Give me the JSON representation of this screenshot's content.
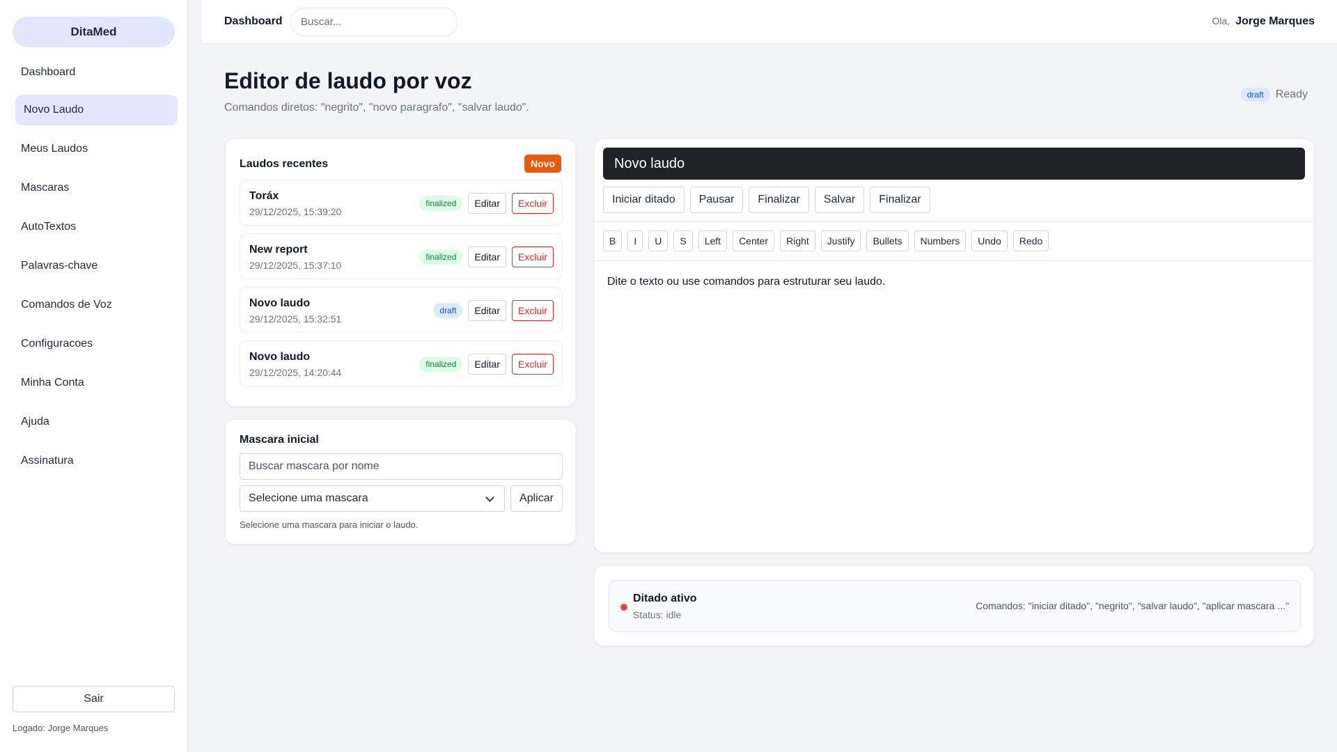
{
  "sidebar": {
    "brand": "DitaMed",
    "items": [
      {
        "label": "Dashboard"
      },
      {
        "label": "Novo Laudo"
      },
      {
        "label": "Meus Laudos"
      },
      {
        "label": "Mascaras"
      },
      {
        "label": "AutoTextos"
      },
      {
        "label": "Palavras-chave"
      },
      {
        "label": "Comandos de Voz"
      },
      {
        "label": "Configuracoes"
      },
      {
        "label": "Minha Conta"
      },
      {
        "label": "Ajuda"
      },
      {
        "label": "Assinatura"
      }
    ],
    "active_item": "Novo Laudo",
    "logout_label": "Sair",
    "logged_in_text": "Logado: Jorge Marques"
  },
  "topbar": {
    "title": "Dashboard",
    "search_placeholder": "Buscar...",
    "greeting": "Ola,",
    "user_name": "Jorge Marques"
  },
  "header": {
    "title": "Editor de laudo por voz",
    "subtitle": "Comandos diretos: \"negrito\", \"novo paragrafo\", \"salvar laudo\".",
    "status_badge": "draft",
    "status_text": "Ready"
  },
  "recent": {
    "title": "Laudos recentes",
    "new_label": "Novo",
    "edit_label": "Editar",
    "delete_label": "Excluir",
    "reports": [
      {
        "name": "Toráx",
        "date": "29/12/2025, 15:39:20",
        "status": "finalized"
      },
      {
        "name": "New report",
        "date": "29/12/2025, 15:37:10",
        "status": "finalized"
      },
      {
        "name": "Novo laudo",
        "date": "29/12/2025, 15:32:51",
        "status": "draft"
      },
      {
        "name": "Novo laudo",
        "date": "29/12/2025, 14:20:44",
        "status": "finalized"
      }
    ]
  },
  "mask": {
    "title": "Mascara inicial",
    "search_placeholder": "Buscar mascara por nome",
    "select_value": "Selecione uma mascara",
    "apply_label": "Aplicar",
    "hint": "Selecione uma mascara para iniciar o laudo."
  },
  "editor": {
    "title_value": "Novo laudo",
    "actions": [
      "Iniciar ditado",
      "Pausar",
      "Finalizar",
      "Salvar",
      "Finalizar"
    ],
    "format_buttons": [
      "B",
      "I",
      "U",
      "S",
      "Left",
      "Center",
      "Right",
      "Justify",
      "Bullets",
      "Numbers",
      "Undo",
      "Redo"
    ],
    "placeholder": "Dite o texto ou use comandos para estruturar seu laudo."
  },
  "dictation": {
    "title": "Ditado ativo",
    "status": "Status: idle",
    "commands": "Comandos: \"iniciar ditado\", \"negrito\", \"salvar laudo\", \"aplicar mascara ...\"",
    "dot_color": "#ef4444"
  },
  "colors": {
    "accent": "#e0e7ff",
    "new_button": "#ea580c",
    "danger": "#dc2626",
    "finalized": "#15803d",
    "draft": "#1d4ed8"
  }
}
